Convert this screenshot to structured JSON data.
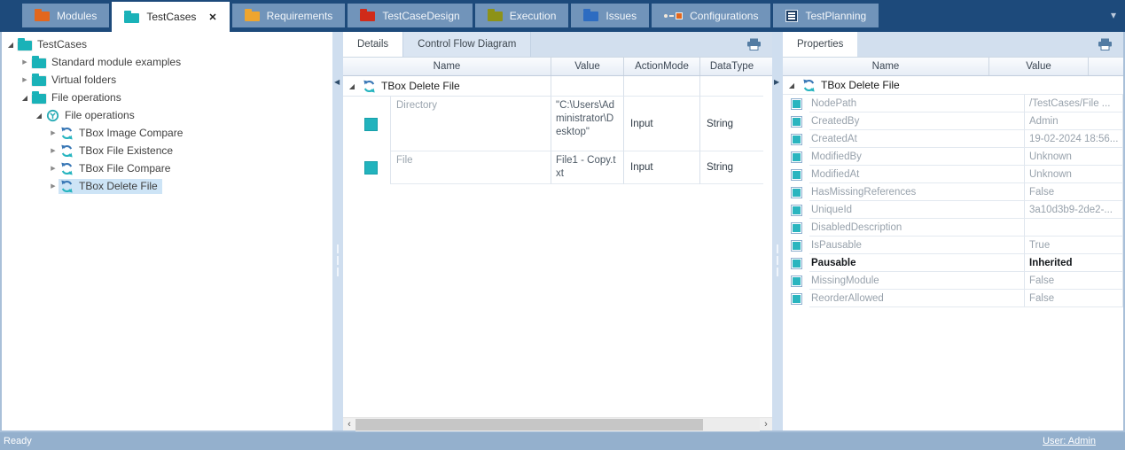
{
  "icons": {
    "expanded": "◢",
    "collapsed": "▶",
    "close": "✕",
    "chevron_down": "▾",
    "scroll_left": "‹",
    "scroll_right": "›",
    "splitter_left": "◀",
    "splitter_right": "▶"
  },
  "colors": {
    "teal": "#1fb3bb",
    "refresh_blue": "#3a78b6",
    "refresh_teal": "#28b5c0",
    "tabbar_bg": "#1d4a7b",
    "inactive_tab": "#7194ba",
    "selection": "#cde4f6",
    "statusbar": "#94b0cd",
    "folder_modules": "#e2671e",
    "folder_testcases": "#1ab2b8",
    "folder_requirements": "#eea52f",
    "folder_testcasedesign": "#d02b1a",
    "folder_execution": "#8d9218",
    "folder_issues": "#2d6cc1"
  },
  "tabbar": {
    "tabs": [
      {
        "label": "Modules",
        "icon": "folder",
        "color": "#e2671e",
        "active": false
      },
      {
        "label": "TestCases",
        "icon": "folder",
        "color": "#1ab2b8",
        "active": true,
        "closable": true
      },
      {
        "label": "Requirements",
        "icon": "folder",
        "color": "#eea52f",
        "active": false
      },
      {
        "label": "TestCaseDesign",
        "icon": "folder",
        "color": "#d02b1a",
        "active": false
      },
      {
        "label": "Execution",
        "icon": "folder",
        "color": "#8d9218",
        "active": false
      },
      {
        "label": "Issues",
        "icon": "folder",
        "color": "#2d6cc1",
        "active": false
      },
      {
        "label": "Configurations",
        "icon": "connector",
        "active": false
      },
      {
        "label": "TestPlanning",
        "icon": "list",
        "active": false
      }
    ]
  },
  "tree": {
    "items": [
      {
        "label": "TestCases",
        "icon": "folder",
        "level": 0,
        "expand": "expanded",
        "selected": false
      },
      {
        "label": "Standard module examples",
        "icon": "folder",
        "level": 1,
        "expand": "collapsed",
        "selected": false
      },
      {
        "label": "Virtual folders",
        "icon": "folder",
        "level": 1,
        "expand": "collapsed",
        "selected": false
      },
      {
        "label": "File operations",
        "icon": "folder",
        "level": 1,
        "expand": "expanded",
        "selected": false
      },
      {
        "label": "File operations",
        "icon": "testcase",
        "level": 2,
        "expand": "expanded",
        "selected": false
      },
      {
        "label": "TBox Image Compare",
        "icon": "refresh",
        "level": 3,
        "expand": "collapsed",
        "selected": false
      },
      {
        "label": "TBox File Existence",
        "icon": "refresh",
        "level": 3,
        "expand": "collapsed",
        "selected": false
      },
      {
        "label": "TBox File Compare",
        "icon": "refresh",
        "level": 3,
        "expand": "collapsed",
        "selected": false
      },
      {
        "label": "TBox Delete File",
        "icon": "refresh",
        "level": 3,
        "expand": "collapsed",
        "selected": true
      }
    ]
  },
  "details": {
    "tabs": [
      "Details",
      "Control Flow Diagram"
    ],
    "columns": [
      "Name",
      "Value",
      "ActionMode",
      "DataType"
    ],
    "group": {
      "label": "TBox Delete File"
    },
    "rows": [
      {
        "name": "Directory",
        "value": "\"C:\\Users\\Administrator\\Desktop\"",
        "action_mode": "Input",
        "data_type": "String"
      },
      {
        "name": "File",
        "value": "File1 - Copy.txt",
        "action_mode": "Input",
        "data_type": "String"
      }
    ]
  },
  "properties": {
    "tab": "Properties",
    "columns": [
      "Name",
      "Value"
    ],
    "group": {
      "label": "TBox Delete File"
    },
    "rows": [
      {
        "name": "NodePath",
        "value": "/TestCases/File ...",
        "bold": false
      },
      {
        "name": "CreatedBy",
        "value": "Admin",
        "bold": false
      },
      {
        "name": "CreatedAt",
        "value": "19-02-2024 18:56...",
        "bold": false
      },
      {
        "name": "ModifiedBy",
        "value": "Unknown",
        "bold": false
      },
      {
        "name": "ModifiedAt",
        "value": "Unknown",
        "bold": false
      },
      {
        "name": "HasMissingReferences",
        "value": "False",
        "bold": false
      },
      {
        "name": "UniqueId",
        "value": "3a10d3b9-2de2-...",
        "bold": false
      },
      {
        "name": "DisabledDescription",
        "value": "",
        "bold": false
      },
      {
        "name": "IsPausable",
        "value": "True",
        "bold": false
      },
      {
        "name": "Pausable",
        "value": "Inherited",
        "bold": true
      },
      {
        "name": "MissingModule",
        "value": "False",
        "bold": false
      },
      {
        "name": "ReorderAllowed",
        "value": "False",
        "bold": false
      }
    ]
  },
  "statusbar": {
    "ready": "Ready",
    "user": "User: Admin"
  }
}
